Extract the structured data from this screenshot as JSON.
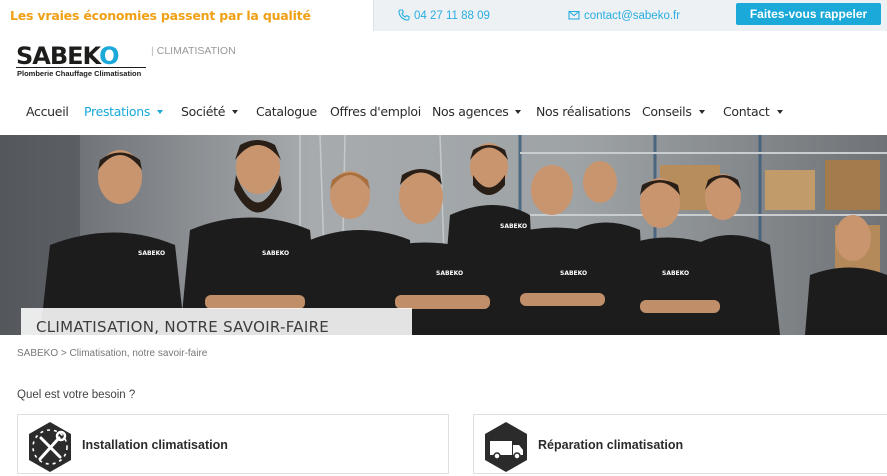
{
  "topbar": {
    "tagline": "Les vraies économies passent par la qualité",
    "phone": "04 27 11 88 09",
    "email": "contact@sabeko.fr",
    "callback_label": "Faites-vous rappeler"
  },
  "logo": {
    "wordmark_start": "SABEK",
    "wordmark_o": "O",
    "subline": "Plomberie Chauffage Climatisation"
  },
  "section_tag": "CLIMATISATION",
  "nav": {
    "items": [
      {
        "label": "Accueil"
      },
      {
        "label": "Prestations"
      },
      {
        "label": "Société"
      },
      {
        "label": "Catalogue"
      },
      {
        "label": "Offres d'emploi"
      },
      {
        "label": "Nos agences"
      },
      {
        "label": "Nos réalisations"
      },
      {
        "label": "Conseils"
      },
      {
        "label": "Contact"
      }
    ]
  },
  "hero": {
    "title": "CLIMATISATION, NOTRE SAVOIR-FAIRE"
  },
  "breadcrumb": "SABEKO > Climatisation, notre savoir-faire",
  "question": "Quel est votre besoin ?",
  "cards": [
    {
      "label": "Installation climatisation",
      "icon": "wrench-screwdriver-icon"
    },
    {
      "label": "Réparation climatisation",
      "icon": "van-icon"
    }
  ],
  "colors": {
    "accent": "#1aa9d9",
    "tagline": "#f0a014",
    "badge": "#2b2b2b"
  }
}
